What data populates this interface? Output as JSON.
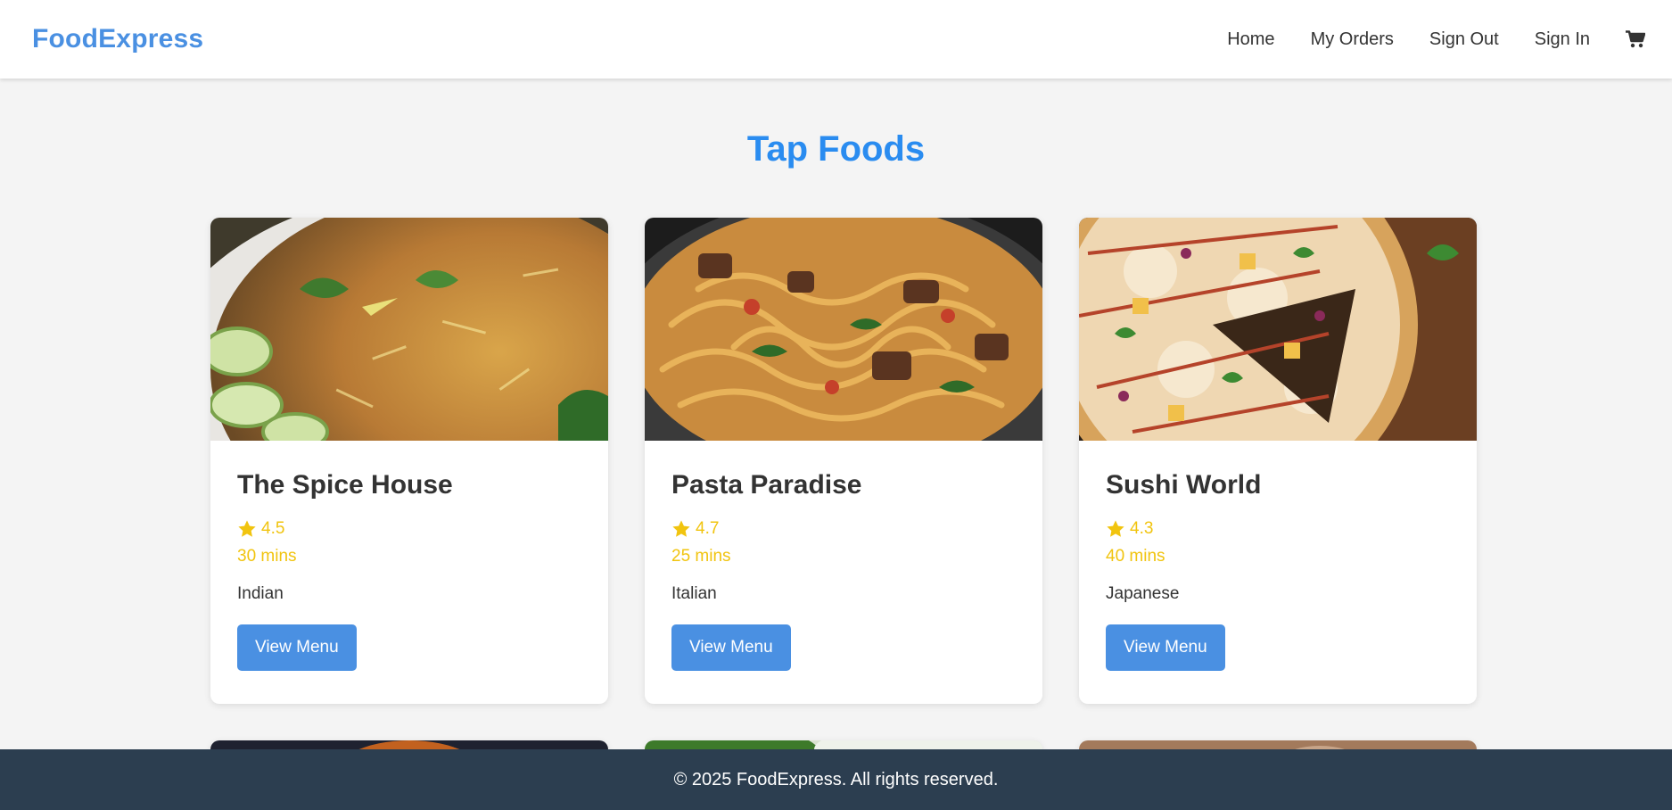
{
  "header": {
    "brand": "FoodExpress",
    "nav": [
      "Home",
      "My Orders",
      "Sign Out",
      "Sign In"
    ],
    "cart_icon": "cart-icon"
  },
  "main": {
    "title": "Tap Foods",
    "restaurants": [
      {
        "name": "The Spice House",
        "rating": "4.5",
        "time": "30 mins",
        "cuisine": "Indian",
        "button": "View Menu",
        "photo": "biryani"
      },
      {
        "name": "Pasta Paradise",
        "rating": "4.7",
        "time": "25 mins",
        "cuisine": "Italian",
        "button": "View Menu",
        "photo": "pasta"
      },
      {
        "name": "Sushi World",
        "rating": "4.3",
        "time": "40 mins",
        "cuisine": "Japanese",
        "button": "View Menu",
        "photo": "pizza"
      }
    ]
  },
  "footer": {
    "text": "© 2025 FoodExpress. All rights reserved."
  },
  "colors": {
    "brand": "#4a90e2",
    "title": "#2a8cf0",
    "rating": "#f1c40f",
    "button": "#4a90e2",
    "footer": "#2c3e50",
    "background": "#f4f4f4"
  }
}
